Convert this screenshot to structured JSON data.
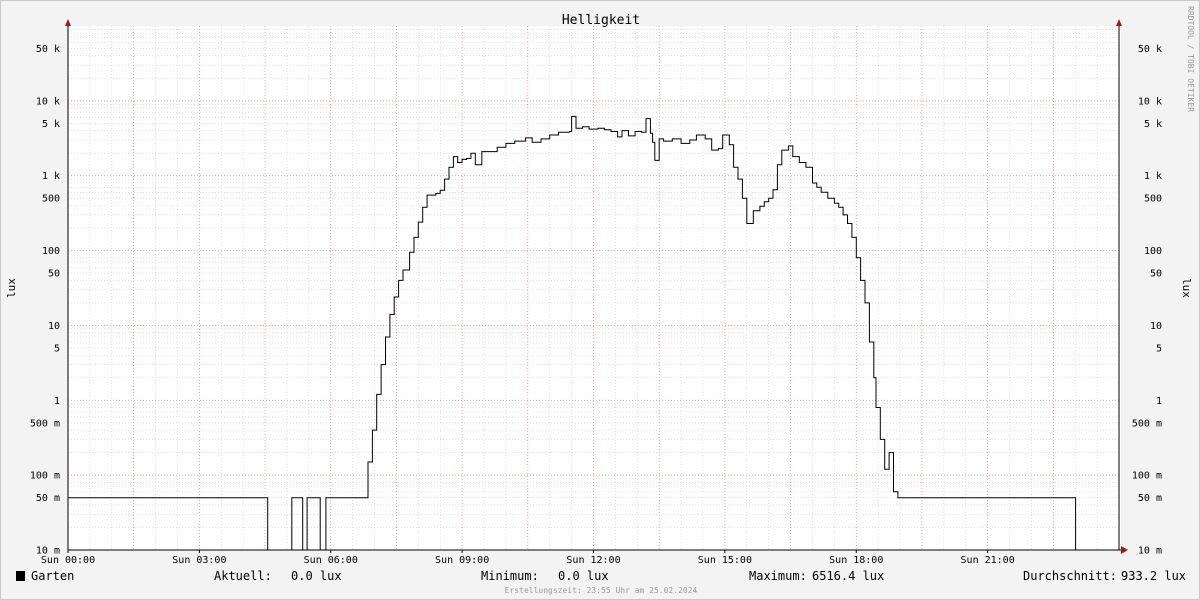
{
  "chart_data": {
    "type": "line",
    "title": "Helligkeit",
    "ylabel": "lux",
    "y_scale": "log",
    "ylim": [
      0.01,
      100000
    ],
    "xlim": [
      0,
      24
    ],
    "x_ticks": [
      {
        "h": 0,
        "label": "Sun 00:00"
      },
      {
        "h": 3,
        "label": "Sun 03:00"
      },
      {
        "h": 6,
        "label": "Sun 06:00"
      },
      {
        "h": 9,
        "label": "Sun 09:00"
      },
      {
        "h": 12,
        "label": "Sun 12:00"
      },
      {
        "h": 15,
        "label": "Sun 15:00"
      },
      {
        "h": 18,
        "label": "Sun 18:00"
      },
      {
        "h": 21,
        "label": "Sun 21:00"
      }
    ],
    "y_ticks": [
      {
        "v": 0.01,
        "label": "10 m"
      },
      {
        "v": 0.05,
        "label": "50 m"
      },
      {
        "v": 0.1,
        "label": "100 m"
      },
      {
        "v": 0.5,
        "label": "500 m"
      },
      {
        "v": 1,
        "label": "1"
      },
      {
        "v": 5,
        "label": "5"
      },
      {
        "v": 10,
        "label": "10"
      },
      {
        "v": 50,
        "label": "50"
      },
      {
        "v": 100,
        "label": "100"
      },
      {
        "v": 500,
        "label": "500"
      },
      {
        "v": 1000,
        "label": "1 k"
      },
      {
        "v": 5000,
        "label": "5 k"
      },
      {
        "v": 10000,
        "label": "10 k"
      },
      {
        "v": 50000,
        "label": "50 k"
      }
    ],
    "grid": true,
    "series": [
      {
        "name": "Garten",
        "color": "#000000",
        "points": [
          [
            0,
            0.05
          ],
          [
            4.55,
            0.05
          ],
          [
            4.56,
            0.01
          ],
          [
            5.1,
            0.01
          ],
          [
            5.11,
            0.05
          ],
          [
            5.35,
            0.05
          ],
          [
            5.36,
            0.01
          ],
          [
            5.45,
            0.01
          ],
          [
            5.46,
            0.05
          ],
          [
            5.75,
            0.05
          ],
          [
            5.76,
            0.01
          ],
          [
            5.88,
            0.01
          ],
          [
            5.89,
            0.05
          ],
          [
            6.8,
            0.05
          ],
          [
            6.85,
            0.15
          ],
          [
            6.95,
            0.4
          ],
          [
            7.05,
            1.2
          ],
          [
            7.15,
            3
          ],
          [
            7.25,
            7
          ],
          [
            7.35,
            14
          ],
          [
            7.45,
            24
          ],
          [
            7.55,
            40
          ],
          [
            7.65,
            55
          ],
          [
            7.8,
            95
          ],
          [
            7.9,
            150
          ],
          [
            8.0,
            240
          ],
          [
            8.1,
            380
          ],
          [
            8.2,
            550
          ],
          [
            8.4,
            580
          ],
          [
            8.5,
            640
          ],
          [
            8.6,
            900
          ],
          [
            8.7,
            1300
          ],
          [
            8.8,
            1800
          ],
          [
            8.9,
            1500
          ],
          [
            9.0,
            1650
          ],
          [
            9.1,
            1700
          ],
          [
            9.2,
            2000
          ],
          [
            9.3,
            1400
          ],
          [
            9.45,
            2100
          ],
          [
            9.6,
            2100
          ],
          [
            9.8,
            2400
          ],
          [
            10.0,
            2700
          ],
          [
            10.2,
            2900
          ],
          [
            10.45,
            3200
          ],
          [
            10.6,
            2800
          ],
          [
            10.8,
            3100
          ],
          [
            11.0,
            3500
          ],
          [
            11.2,
            3800
          ],
          [
            11.45,
            3900
          ],
          [
            11.5,
            6200
          ],
          [
            11.6,
            4300
          ],
          [
            11.75,
            4500
          ],
          [
            11.9,
            4200
          ],
          [
            12.1,
            4300
          ],
          [
            12.25,
            4100
          ],
          [
            12.4,
            3900
          ],
          [
            12.55,
            3300
          ],
          [
            12.65,
            4000
          ],
          [
            12.8,
            3400
          ],
          [
            12.95,
            3900
          ],
          [
            13.1,
            3800
          ],
          [
            13.2,
            5800
          ],
          [
            13.3,
            3700
          ],
          [
            13.35,
            2800
          ],
          [
            13.4,
            1600
          ],
          [
            13.5,
            3100
          ],
          [
            13.6,
            2900
          ],
          [
            13.8,
            3100
          ],
          [
            14.0,
            2700
          ],
          [
            14.2,
            3000
          ],
          [
            14.35,
            3500
          ],
          [
            14.55,
            3100
          ],
          [
            14.7,
            2200
          ],
          [
            14.85,
            2300
          ],
          [
            14.95,
            3500
          ],
          [
            15.1,
            2600
          ],
          [
            15.2,
            1300
          ],
          [
            15.3,
            900
          ],
          [
            15.4,
            500
          ],
          [
            15.5,
            230
          ],
          [
            15.65,
            340
          ],
          [
            15.8,
            390
          ],
          [
            15.9,
            450
          ],
          [
            16.0,
            500
          ],
          [
            16.1,
            650
          ],
          [
            16.2,
            1400
          ],
          [
            16.3,
            2200
          ],
          [
            16.45,
            2500
          ],
          [
            16.55,
            1800
          ],
          [
            16.7,
            1500
          ],
          [
            16.85,
            1300
          ],
          [
            17.0,
            800
          ],
          [
            17.1,
            700
          ],
          [
            17.2,
            600
          ],
          [
            17.35,
            500
          ],
          [
            17.5,
            430
          ],
          [
            17.6,
            380
          ],
          [
            17.7,
            300
          ],
          [
            17.8,
            230
          ],
          [
            17.9,
            150
          ],
          [
            18.0,
            80
          ],
          [
            18.1,
            40
          ],
          [
            18.2,
            20
          ],
          [
            18.3,
            6
          ],
          [
            18.4,
            2
          ],
          [
            18.45,
            0.8
          ],
          [
            18.55,
            0.3
          ],
          [
            18.65,
            0.12
          ],
          [
            18.75,
            0.2
          ],
          [
            18.85,
            0.06
          ],
          [
            18.95,
            0.05
          ],
          [
            23.0,
            0.05
          ],
          [
            23.01,
            0.01
          ],
          [
            24,
            0.01
          ]
        ]
      }
    ]
  },
  "side_label": "RRDTOOL / TOBI OETIKER",
  "legend": {
    "series_name": "Garten",
    "swatch_color": "#000000",
    "current_label": "Aktuell:",
    "current_value": "0.0 lux",
    "min_label": "Minimum:",
    "min_value": "0.0 lux",
    "max_label": "Maximum:",
    "max_value": "6516.4 lux",
    "avg_label": "Durchschnitt:",
    "avg_value": "933.2 lux"
  },
  "footer": "Erstellungszeit: 23:55 Uhr am 25.02.2024",
  "colors": {
    "background": "#f3f3f3",
    "plot_background": "#ffffff",
    "grid_major": "#e08a8a",
    "grid_minor": "#cfcfcf",
    "axis": "#000000",
    "arrow": "#9b1b1b"
  }
}
